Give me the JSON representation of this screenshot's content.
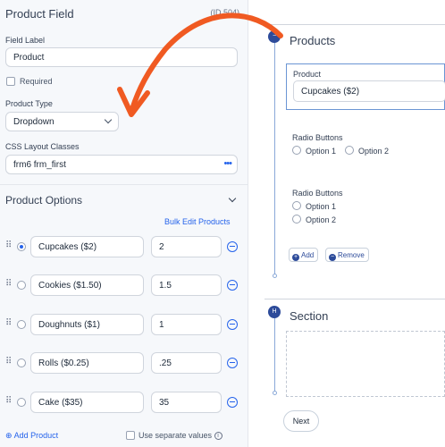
{
  "panel": {
    "title": "Product Field",
    "id_badge": "(ID 504)",
    "field_label_caption": "Field Label",
    "field_label_value": "Product",
    "required_label": "Required",
    "product_type_caption": "Product Type",
    "product_type_value": "Dropdown",
    "css_caption": "CSS Layout Classes",
    "css_value": "frm6 frm_first",
    "css_more": "•••",
    "options_title": "Product Options",
    "bulk_edit": "Bulk Edit Products",
    "options": [
      {
        "name": "Cupcakes ($2)",
        "value": "2",
        "selected": true
      },
      {
        "name": "Cookies ($1.50)",
        "value": "1.5",
        "selected": false
      },
      {
        "name": "Doughnuts ($1)",
        "value": "1",
        "selected": false
      },
      {
        "name": "Rolls ($0.25)",
        "value": ".25",
        "selected": false
      },
      {
        "name": "Cake ($35)",
        "value": "35",
        "selected": false
      }
    ],
    "add_product": "Add Product",
    "separate_values": "Use separate values",
    "info_glyph": "i"
  },
  "canvas": {
    "group1_title": "Products",
    "field_label": "Product",
    "field_value": "Cupcakes ($2)",
    "radio_group1": {
      "label": "Radio Buttons",
      "options": [
        "Option 1",
        "Option 2"
      ]
    },
    "radio_group2": {
      "label": "Radio Buttons",
      "options": [
        "Option 1",
        "Option 2"
      ]
    },
    "add_label": "Add",
    "remove_label": "Remove",
    "section_title": "Section",
    "section_node": "H",
    "next_label": "Next"
  },
  "colors": {
    "accent": "#2563eb",
    "arrow": "#f05a22",
    "node": "#2d4b9a"
  }
}
